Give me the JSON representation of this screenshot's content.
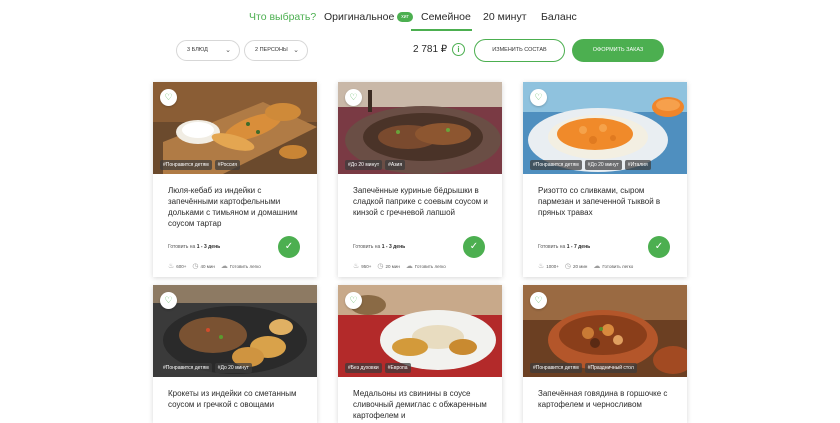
{
  "nav": {
    "tabs": [
      {
        "label": "Что выбрать?"
      },
      {
        "label": "Оригинальное",
        "badge": "хит"
      },
      {
        "label": "Семейное"
      },
      {
        "label": "20 минут"
      },
      {
        "label": "Баланс"
      }
    ]
  },
  "controls": {
    "dishes_select": "3 блюд",
    "persons_select": "2 персоны",
    "price": "2 781 ₽",
    "info_symbol": "i",
    "change_button": "Изменить состав",
    "order_button": "Оформить заказ"
  },
  "icons": {
    "favorite": "heart-outline",
    "selected": "checkmark",
    "calories": "flame",
    "time": "clock",
    "difficulty": "chef-hat"
  },
  "colors": {
    "accent": "#4caf50"
  },
  "cards": [
    {
      "title": "Люля-кебаб из индейки с запечёнными картофельными дольками с тимьяном и домашним соусом тартар",
      "tags": [
        "#Понравится детям",
        "#Россия"
      ],
      "cook_prefix": "Готовить на",
      "cook_days": "1 - 3 день",
      "calories": "600+",
      "time": "40 мин",
      "difficulty": "Готовить легко"
    },
    {
      "title": "Запечённые куриные бёдрышки в сладкой паприке с соевым соусом и кинзой с гречневой лапшой",
      "tags": [
        "#До 20 минут",
        "#Азия"
      ],
      "cook_prefix": "Готовить на",
      "cook_days": "1 - 3 день",
      "calories": "950+",
      "time": "20 мин",
      "difficulty": "Готовить легко"
    },
    {
      "title": "Ризотто со сливками, сыром пармезан и запеченной тыквой в пряных травах",
      "tags": [
        "#Понравится детям",
        "#До 20 минут",
        "#Италия"
      ],
      "cook_prefix": "Готовить на",
      "cook_days": "1 - 7 день",
      "calories": "1000+",
      "time": "20 мин",
      "difficulty": "Готовить легко"
    },
    {
      "title": "Крокеты из индейки со сметанным соусом и гречкой с овощами",
      "tags": [
        "#Понравится детям",
        "#До 20 минут"
      ]
    },
    {
      "title": "Медальоны из свинины в соусе сливочный демиглас с обжаренным картофелем и",
      "tags": [
        "#Без духовки",
        "#Европа"
      ]
    },
    {
      "title": "Запечённая говядина в горшочке с картофелем и черносливом",
      "tags": [
        "#Понравится детям",
        "#Праздничный стол"
      ]
    }
  ]
}
